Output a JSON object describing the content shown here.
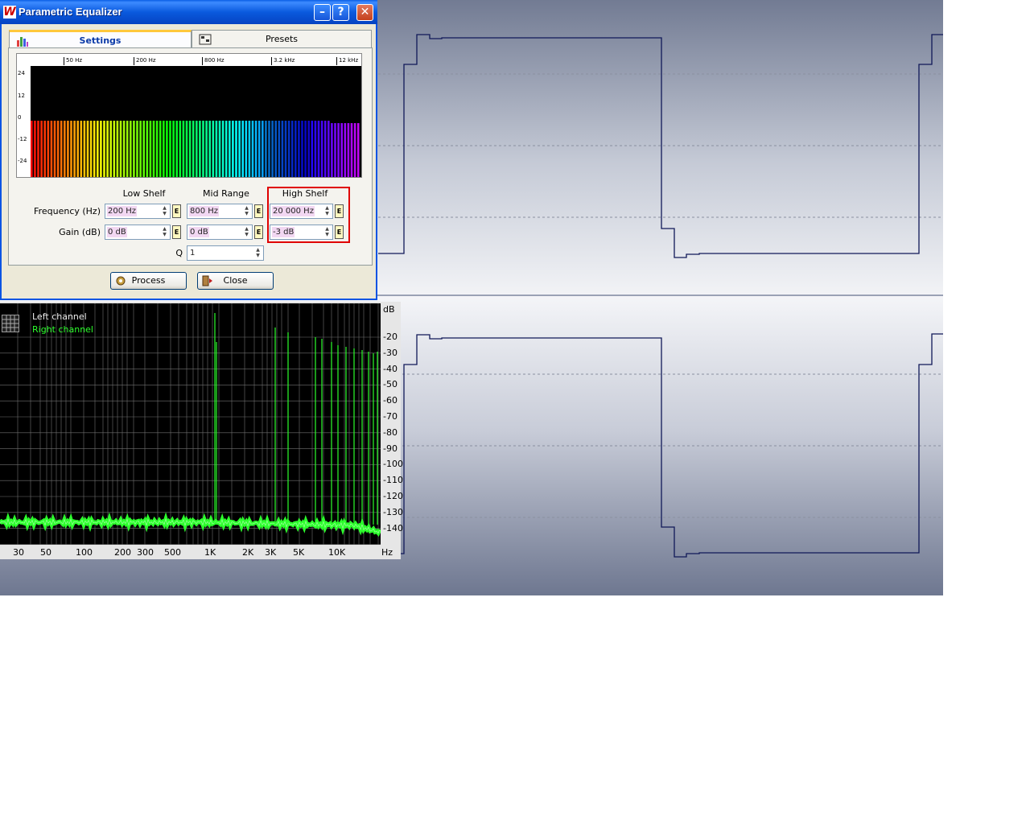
{
  "window": {
    "title": "Parametric Equalizer",
    "app_icon_letter": "W",
    "minimize_glyph": "–",
    "help_glyph": "?",
    "close_glyph": "✕"
  },
  "tabs": [
    {
      "label": "Settings",
      "icon": "equalizer-chart-icon",
      "active": true
    },
    {
      "label": "Presets",
      "icon": "presets-icon",
      "active": false
    }
  ],
  "graph": {
    "freq_ticks": [
      "50 Hz",
      "200 Hz",
      "800 Hz",
      "3.2 kHz",
      "12 kHz"
    ],
    "gain_ticks": [
      "24",
      "12",
      "0",
      "-12",
      "-24"
    ]
  },
  "table": {
    "columns": [
      "Low Shelf",
      "Mid Range",
      "High Shelf"
    ],
    "frequency_label": "Frequency (Hz)",
    "gain_label": "Gain (dB)",
    "q_label": "Q",
    "frequency_values": [
      "200 Hz",
      "800 Hz",
      "20 000 Hz"
    ],
    "gain_values": [
      "0 dB",
      "0 dB",
      "-3 dB"
    ],
    "q_value": "1",
    "edit_glyph": "E"
  },
  "buttons": {
    "process": "Process",
    "close": "Close"
  },
  "spectrum": {
    "legend_left": "Left channel",
    "legend_right": "Right channel",
    "db_unit": "dB",
    "db_ticks": [
      "-20",
      "-30",
      "-40",
      "-50",
      "-60",
      "-70",
      "-80",
      "-90",
      "-100",
      "-110",
      "-120",
      "-130",
      "-140"
    ],
    "hz_ticks": [
      "30",
      "50",
      "100",
      "200",
      "300",
      "500",
      "1K",
      "2K",
      "3K",
      "5K",
      "10K"
    ],
    "hz_unit": "Hz",
    "colors": {
      "left": "#ffffff",
      "right": "#2cff2c"
    }
  }
}
